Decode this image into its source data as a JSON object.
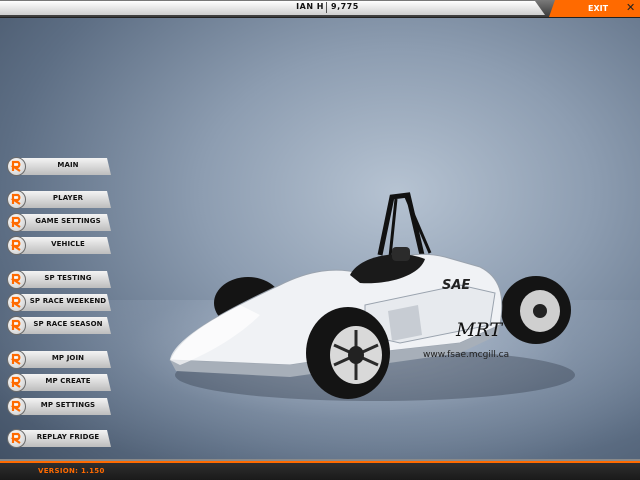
{
  "header": {
    "player_name": "IAN H",
    "player_score": "9,775",
    "exit_label": "EXIT",
    "close_icon": "close-icon"
  },
  "menu": {
    "items": [
      {
        "label": "MAIN"
      },
      {
        "label": "PLAYER"
      },
      {
        "label": "GAME SETTINGS"
      },
      {
        "label": "VEHICLE"
      },
      {
        "label": "SP TESTING"
      },
      {
        "label": "SP RACE WEEKEND"
      },
      {
        "label": "SP RACE SEASON"
      },
      {
        "label": "MP JOIN"
      },
      {
        "label": "MP CREATE"
      },
      {
        "label": "MP SETTINGS"
      },
      {
        "label": "REPLAY FRIDGE"
      }
    ],
    "item_icon": "rfactor-logo-icon"
  },
  "car": {
    "decal_sae": "SAE",
    "decal_team": "MRT",
    "decal_url": "www.fsae.mcgill.ca"
  },
  "footer": {
    "version": "VERSION: 1.150"
  },
  "colors": {
    "accent": "#ff6a00",
    "panel": "#e6e6e6",
    "background": "#7f90a6"
  }
}
